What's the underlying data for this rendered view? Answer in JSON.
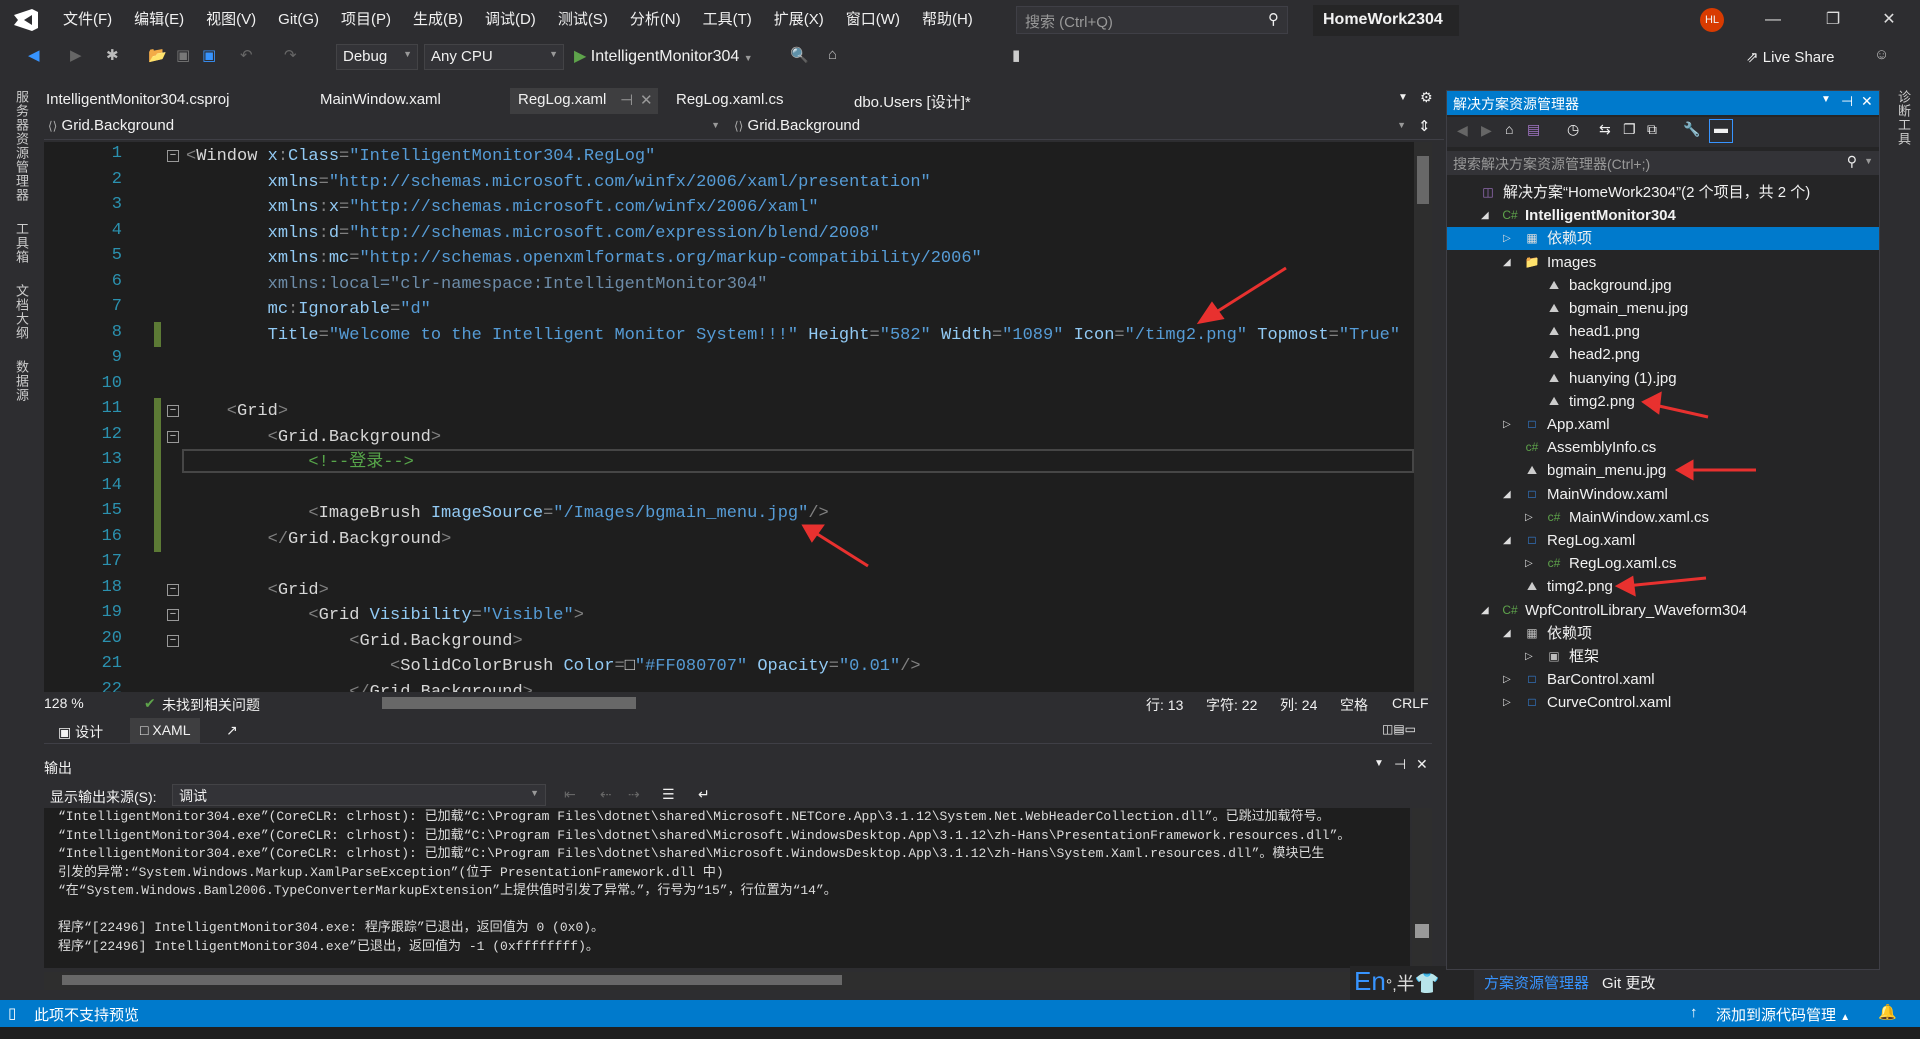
{
  "menu": [
    "文件(F)",
    "编辑(E)",
    "视图(V)",
    "Git(G)",
    "项目(P)",
    "生成(B)",
    "调试(D)",
    "测试(S)",
    "分析(N)",
    "工具(T)",
    "扩展(X)",
    "窗口(W)",
    "帮助(H)"
  ],
  "search": {
    "placeholder": "搜索 (Ctrl+Q)"
  },
  "solution_name": "HomeWork2304",
  "avatar_initials": "HL",
  "toolbar": {
    "config": "Debug",
    "platform": "Any CPU",
    "run_target": "IntelligentMonitor304",
    "live_share": "Live Share"
  },
  "left_tabs": [
    "服务器资源管理器",
    "工具箱",
    "文档大纲",
    "数据源"
  ],
  "right_tabs": [
    "诊断工具"
  ],
  "doc_tabs": [
    {
      "label": "IntelligentMonitor304.csproj"
    },
    {
      "label": "MainWindow.xaml"
    },
    {
      "label": "RegLog.xaml",
      "active": true
    },
    {
      "label": "RegLog.xaml.cs"
    },
    {
      "label": "dbo.Users [设计]*"
    }
  ],
  "nav": {
    "left": "Grid.Background",
    "right": "Grid.Background"
  },
  "code": [
    {
      "n": "1",
      "t": [
        [
          "b",
          "<"
        ],
        [
          "e",
          "Window "
        ],
        [
          "a",
          "x"
        ],
        [
          "b",
          ":"
        ],
        [
          "a",
          "Class"
        ],
        [
          "b",
          "="
        ],
        [
          "q",
          "\""
        ],
        [
          "s",
          "IntelligentMonitor304.RegLog"
        ],
        [
          "q",
          "\""
        ]
      ]
    },
    {
      "n": "2",
      "t": [
        [
          "a",
          "        xmlns"
        ],
        [
          "b",
          "="
        ],
        [
          "q",
          "\""
        ],
        [
          "s",
          "http://schemas.microsoft.com/winfx/2006/xaml/presentation"
        ],
        [
          "q",
          "\""
        ]
      ]
    },
    {
      "n": "3",
      "t": [
        [
          "a",
          "        xmlns"
        ],
        [
          "b",
          ":"
        ],
        [
          "a",
          "x"
        ],
        [
          "b",
          "="
        ],
        [
          "q",
          "\""
        ],
        [
          "s",
          "http://schemas.microsoft.com/winfx/2006/xaml"
        ],
        [
          "q",
          "\""
        ]
      ]
    },
    {
      "n": "4",
      "t": [
        [
          "a",
          "        xmlns"
        ],
        [
          "b",
          ":"
        ],
        [
          "a",
          "d"
        ],
        [
          "b",
          "="
        ],
        [
          "q",
          "\""
        ],
        [
          "s",
          "http://schemas.microsoft.com/expression/blend/2008"
        ],
        [
          "q",
          "\""
        ]
      ]
    },
    {
      "n": "5",
      "t": [
        [
          "a",
          "        xmlns"
        ],
        [
          "b",
          ":"
        ],
        [
          "a",
          "mc"
        ],
        [
          "b",
          "="
        ],
        [
          "q",
          "\""
        ],
        [
          "s",
          "http://schemas.openxmlformats.org/markup-compatibility/2006"
        ],
        [
          "q",
          "\""
        ]
      ]
    },
    {
      "n": "6",
      "t": [
        [
          "d",
          "        xmlns:local=\"clr-namespace:IntelligentMonitor304\""
        ]
      ]
    },
    {
      "n": "7",
      "t": [
        [
          "a",
          "        mc"
        ],
        [
          "b",
          ":"
        ],
        [
          "a",
          "Ignorable"
        ],
        [
          "b",
          "="
        ],
        [
          "q",
          "\""
        ],
        [
          "s",
          "d"
        ],
        [
          "q",
          "\""
        ]
      ]
    },
    {
      "n": "8",
      "t": [
        [
          "a",
          "        Title"
        ],
        [
          "b",
          "="
        ],
        [
          "q",
          "\""
        ],
        [
          "s",
          "Welcome to the Intelligent Monitor System!!!"
        ],
        [
          "q",
          "\""
        ],
        [
          "a",
          " Height"
        ],
        [
          "b",
          "="
        ],
        [
          "q",
          "\""
        ],
        [
          "s",
          "582"
        ],
        [
          "q",
          "\""
        ],
        [
          "a",
          " Width"
        ],
        [
          "b",
          "="
        ],
        [
          "q",
          "\""
        ],
        [
          "s",
          "1089"
        ],
        [
          "q",
          "\""
        ],
        [
          "a",
          " Icon"
        ],
        [
          "b",
          "="
        ],
        [
          "q",
          "\""
        ],
        [
          "s",
          "/timg2.png"
        ],
        [
          "q",
          "\""
        ],
        [
          "a",
          " Topmost"
        ],
        [
          "b",
          "="
        ],
        [
          "q",
          "\""
        ],
        [
          "s",
          "True"
        ],
        [
          "q",
          "\""
        ]
      ]
    },
    {
      "n": "9",
      "t": []
    },
    {
      "n": "10",
      "t": []
    },
    {
      "n": "11",
      "t": [
        [
          "b",
          "    <"
        ],
        [
          "e",
          "Grid"
        ],
        [
          "b",
          ">"
        ]
      ]
    },
    {
      "n": "12",
      "t": [
        [
          "b",
          "        <"
        ],
        [
          "e",
          "Grid.Background"
        ],
        [
          "b",
          ">"
        ]
      ]
    },
    {
      "n": "13",
      "t": [
        [
          "c",
          "            <!--登录-->"
        ]
      ]
    },
    {
      "n": "14",
      "t": []
    },
    {
      "n": "15",
      "t": [
        [
          "b",
          "            <"
        ],
        [
          "e",
          "ImageBrush "
        ],
        [
          "a",
          "ImageSource"
        ],
        [
          "b",
          "="
        ],
        [
          "q",
          "\""
        ],
        [
          "s",
          "/Images/bgmain_menu.jpg"
        ],
        [
          "q",
          "\""
        ],
        [
          "b",
          "/>"
        ]
      ]
    },
    {
      "n": "16",
      "t": [
        [
          "b",
          "        </"
        ],
        [
          "e",
          "Grid.Background"
        ],
        [
          "b",
          ">"
        ]
      ]
    },
    {
      "n": "17",
      "t": []
    },
    {
      "n": "18",
      "t": [
        [
          "b",
          "        <"
        ],
        [
          "e",
          "Grid"
        ],
        [
          "b",
          ">"
        ]
      ]
    },
    {
      "n": "19",
      "t": [
        [
          "b",
          "            <"
        ],
        [
          "e",
          "Grid "
        ],
        [
          "a",
          "Visibility"
        ],
        [
          "b",
          "="
        ],
        [
          "q",
          "\""
        ],
        [
          "s",
          "Visible"
        ],
        [
          "q",
          "\""
        ],
        [
          "b",
          ">"
        ]
      ]
    },
    {
      "n": "20",
      "t": [
        [
          "b",
          "                <"
        ],
        [
          "e",
          "Grid.Background"
        ],
        [
          "b",
          ">"
        ]
      ]
    },
    {
      "n": "21",
      "t": [
        [
          "b",
          "                    <"
        ],
        [
          "e",
          "SolidColorBrush "
        ],
        [
          "a",
          "Color"
        ],
        [
          "b",
          "="
        ],
        [
          "e",
          "□"
        ],
        [
          "q",
          "\""
        ],
        [
          "s",
          "#FF080707"
        ],
        [
          "q",
          "\""
        ],
        [
          "a",
          " Opacity"
        ],
        [
          "b",
          "="
        ],
        [
          "q",
          "\""
        ],
        [
          "s",
          "0.01"
        ],
        [
          "q",
          "\""
        ],
        [
          "b",
          "/>"
        ]
      ]
    },
    {
      "n": "22",
      "t": [
        [
          "b",
          "                </"
        ],
        [
          "e",
          "Grid.Background"
        ],
        [
          "b",
          ">"
        ]
      ]
    }
  ],
  "editor_status": {
    "zoom": "128 %",
    "issues": "未找到相关问题",
    "line": "行: 13",
    "char": "字符: 22",
    "col": "列: 24",
    "whitespace": "空格",
    "eol": "CRLF"
  },
  "view_tabs": {
    "design": "设计",
    "xaml": "XAML"
  },
  "output": {
    "title": "输出",
    "source_label": "显示输出来源(S):",
    "source_value": "调试",
    "lines": [
      "“IntelligentMonitor304.exe”(CoreCLR: clrhost): 已加载“C:\\Program Files\\dotnet\\shared\\Microsoft.NETCore.App\\3.1.12\\System.Net.WebHeaderCollection.dll”。已跳过加载符号。",
      "“IntelligentMonitor304.exe”(CoreCLR: clrhost): 已加载“C:\\Program Files\\dotnet\\shared\\Microsoft.WindowsDesktop.App\\3.1.12\\zh-Hans\\PresentationFramework.resources.dll”。",
      "“IntelligentMonitor304.exe”(CoreCLR: clrhost): 已加载“C:\\Program Files\\dotnet\\shared\\Microsoft.WindowsDesktop.App\\3.1.12\\zh-Hans\\System.Xaml.resources.dll”。模块已生",
      "引发的异常:“System.Windows.Markup.XamlParseException”(位于 PresentationFramework.dll 中)",
      "“在“System.Windows.Baml2006.TypeConverterMarkupExtension”上提供值时引发了异常。”，行号为“15”，行位置为“14”。",
      "",
      "程序“[22496] IntelligentMonitor304.exe: 程序跟踪”已退出，返回值为 0 (0x0)。",
      "程序“[22496] IntelligentMonitor304.exe”已退出，返回值为 -1 (0xffffffff)。"
    ]
  },
  "ime": {
    "lang": "En",
    "punct": "°,",
    "width": "半"
  },
  "status_bar": {
    "left": "此项不支持预览",
    "source_control": "添加到源代码管理"
  },
  "solution_explorer": {
    "title": "解决方案资源管理器",
    "search_placeholder": "搜索解决方案资源管理器(Ctrl+;)",
    "tree": [
      {
        "label": "解决方案“HomeWork2304”(2 个项目，共 2 个)",
        "level": 0,
        "icon": "solution",
        "exp": ""
      },
      {
        "label": "IntelligentMonitor304",
        "level": 1,
        "icon": "csproj",
        "exp": "open",
        "bold": true
      },
      {
        "label": "依赖项",
        "level": 2,
        "icon": "dependencies-warning",
        "exp": "closed",
        "selected": true
      },
      {
        "label": "Images",
        "level": 2,
        "icon": "folder",
        "exp": "open"
      },
      {
        "label": "background.jpg",
        "level": 3,
        "icon": "image",
        "exp": ""
      },
      {
        "label": "bgmain_menu.jpg",
        "level": 3,
        "icon": "image",
        "exp": ""
      },
      {
        "label": "head1.png",
        "level": 3,
        "icon": "image",
        "exp": ""
      },
      {
        "label": "head2.png",
        "level": 3,
        "icon": "image",
        "exp": ""
      },
      {
        "label": "huanying (1).jpg",
        "level": 3,
        "icon": "image",
        "exp": ""
      },
      {
        "label": "timg2.png",
        "level": 3,
        "icon": "image",
        "exp": ""
      },
      {
        "label": "App.xaml",
        "level": 2,
        "icon": "xaml",
        "exp": "closed"
      },
      {
        "label": "AssemblyInfo.cs",
        "level": 2,
        "icon": "cs",
        "exp": ""
      },
      {
        "label": "bgmain_menu.jpg",
        "level": 2,
        "icon": "image",
        "exp": ""
      },
      {
        "label": "MainWindow.xaml",
        "level": 2,
        "icon": "xaml",
        "exp": "open"
      },
      {
        "label": "MainWindow.xaml.cs",
        "level": 3,
        "icon": "cs",
        "exp": "closed"
      },
      {
        "label": "RegLog.xaml",
        "level": 2,
        "icon": "xaml",
        "exp": "open"
      },
      {
        "label": "RegLog.xaml.cs",
        "level": 3,
        "icon": "cs",
        "exp": "closed"
      },
      {
        "label": "timg2.png",
        "level": 2,
        "icon": "image",
        "exp": ""
      },
      {
        "label": "WpfControlLibrary_Waveform304",
        "level": 1,
        "icon": "csproj",
        "exp": "open"
      },
      {
        "label": "依赖项",
        "level": 2,
        "icon": "dependencies",
        "exp": "open"
      },
      {
        "label": "框架",
        "level": 3,
        "icon": "framework",
        "exp": "closed"
      },
      {
        "label": "BarControl.xaml",
        "level": 2,
        "icon": "xaml",
        "exp": "closed"
      },
      {
        "label": "CurveControl.xaml",
        "level": 2,
        "icon": "xaml",
        "exp": "closed"
      }
    ],
    "bottom_tabs": [
      "方案资源管理器",
      "Git 更改"
    ]
  },
  "colors": {
    "accent": "#007acc",
    "annotation_arrow": "#e8312f",
    "avatar": "#d83b01"
  }
}
